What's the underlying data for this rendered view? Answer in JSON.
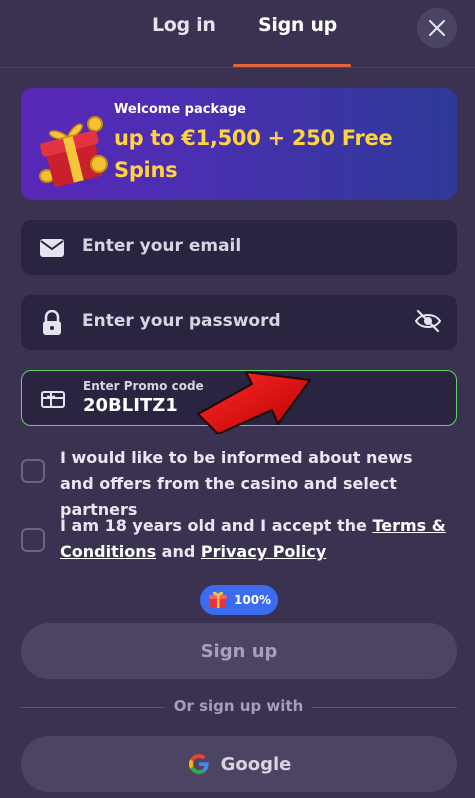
{
  "tabs": {
    "login": "Log in",
    "signup": "Sign up"
  },
  "banner": {
    "kicker": "Welcome package",
    "headline": "up to €1,500 + 250 Free Spins"
  },
  "fields": {
    "email_placeholder": "Enter your email",
    "password_placeholder": "Enter your password",
    "promo_label": "Enter Promo code",
    "promo_value": "20BLITZ1"
  },
  "consents": {
    "news_text": "I would like to be informed about news and offers from the casino and select partners",
    "terms_prefix": "I am 18 years old and I accept the ",
    "terms_link": "Terms & Conditions",
    "terms_and": " and ",
    "privacy_link": "Privacy Policy"
  },
  "bonus_badge": {
    "percent": "100%"
  },
  "buttons": {
    "signup": "Sign up",
    "divider": "Or sign up with",
    "google": "Google"
  },
  "colors": {
    "background": "#3a3250",
    "tab_accent": "#e8643a",
    "promo_border": "#5fd16a",
    "headline_yellow": "#ffd23f",
    "badge_blue": "#3b6cf0"
  }
}
